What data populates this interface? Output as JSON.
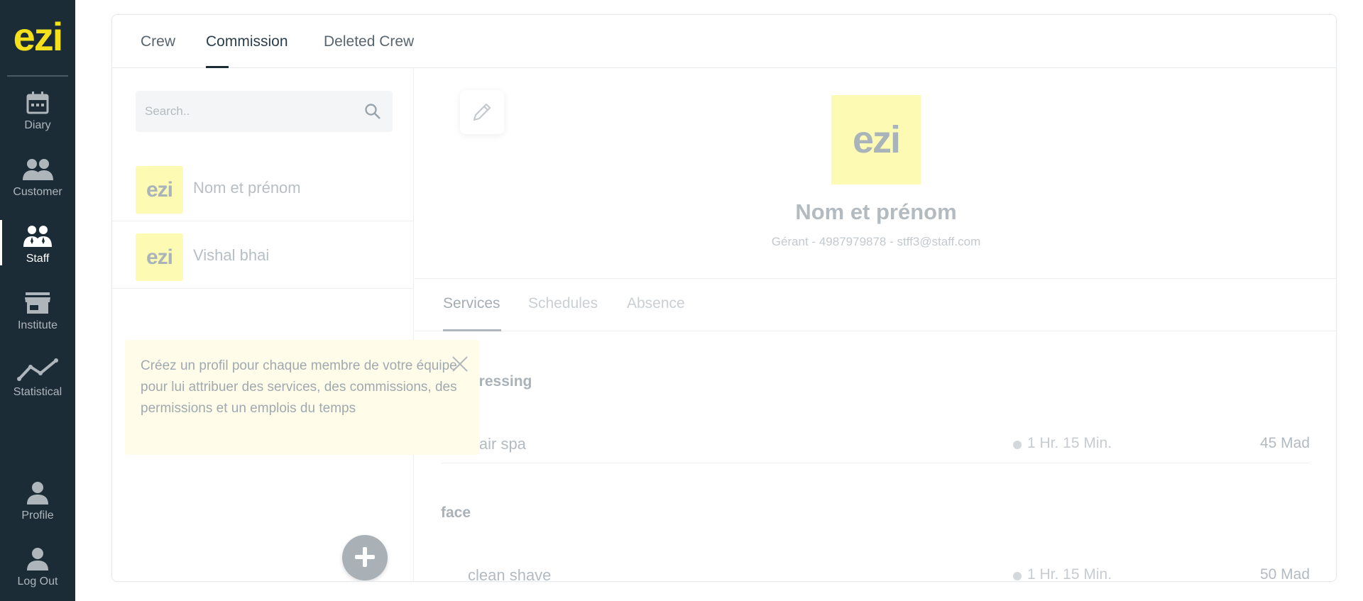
{
  "brand": {
    "logo_text": "ezi",
    "accent_color": "#f5e11b",
    "sidebar_color": "#1c2c36",
    "avatar_bg": "#fdfab3"
  },
  "sidebar": {
    "items": [
      {
        "label": "Diary",
        "icon": "calendar-icon",
        "active": false
      },
      {
        "label": "Customer",
        "icon": "customers-icon",
        "active": false
      },
      {
        "label": "Staff",
        "icon": "staff-icon",
        "active": true
      },
      {
        "label": "Institute",
        "icon": "store-icon",
        "active": false
      },
      {
        "label": "Statistical",
        "icon": "line-chart-icon",
        "active": false
      },
      {
        "label": "Profile",
        "icon": "person-icon",
        "active": false
      },
      {
        "label": "Log Out",
        "icon": "logout-person-icon",
        "active": false
      }
    ]
  },
  "top_tabs": [
    {
      "label": "Crew",
      "active": false
    },
    {
      "label": "Commission",
      "active": true
    },
    {
      "label": "Deleted Crew",
      "active": false
    }
  ],
  "search": {
    "placeholder": "Search..",
    "value": ""
  },
  "crew": [
    {
      "avatar_text": "ezi",
      "name": "Nom et prénom"
    },
    {
      "avatar_text": "ezi",
      "name": "Vishal bhai"
    }
  ],
  "tooltip": {
    "text": "Créez un profil pour chaque membre de votre équipe pour lui attribuer des services, des commissions, des permissions et un emplois du temps"
  },
  "add_button": {
    "icon": "plus-icon"
  },
  "profile": {
    "avatar_text": "ezi",
    "name": "Nom et prénom",
    "meta": "Gérant - 4987979878 - stff3@staff.com"
  },
  "sub_tabs": [
    {
      "label": "Services",
      "active": true
    },
    {
      "label": "Schedules",
      "active": false
    },
    {
      "label": "Absence",
      "active": false
    }
  ],
  "services": [
    {
      "category": "Hairdressing",
      "items": [
        {
          "name": "Hair spa",
          "duration": "1 Hr. 15 Min.",
          "price": "45 Mad"
        }
      ]
    },
    {
      "category": "face",
      "items": [
        {
          "name": "clean shave",
          "duration": "1 Hr. 15 Min.",
          "price": "50 Mad"
        }
      ]
    }
  ]
}
